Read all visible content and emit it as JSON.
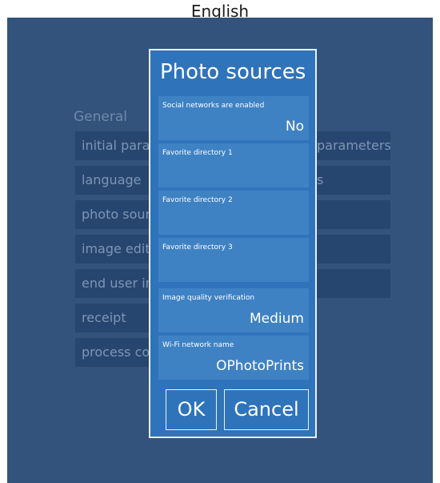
{
  "top_text": "English",
  "background": {
    "left_section_title": "General",
    "right_section_title": "s",
    "left_items": [
      "initial parameters",
      "language",
      "photo sources",
      "image editing",
      "end user interface",
      "receipt",
      "process control"
    ],
    "right_items": [
      "parameters",
      "s",
      "",
      "",
      ""
    ]
  },
  "dialog": {
    "title": "Photo sources",
    "fields": [
      {
        "label": "Social networks are enabled",
        "value": "No"
      },
      {
        "label": "Favorite directory 1",
        "value": ""
      },
      {
        "label": "Favorite directory 2",
        "value": ""
      },
      {
        "label": "Favorite directory 3",
        "value": ""
      },
      {
        "label": "Image quality verification",
        "value": "Medium"
      },
      {
        "label": "Wi-Fi network name",
        "value": "OPhotoPrints"
      }
    ],
    "ok_label": "OK",
    "cancel_label": "Cancel"
  }
}
